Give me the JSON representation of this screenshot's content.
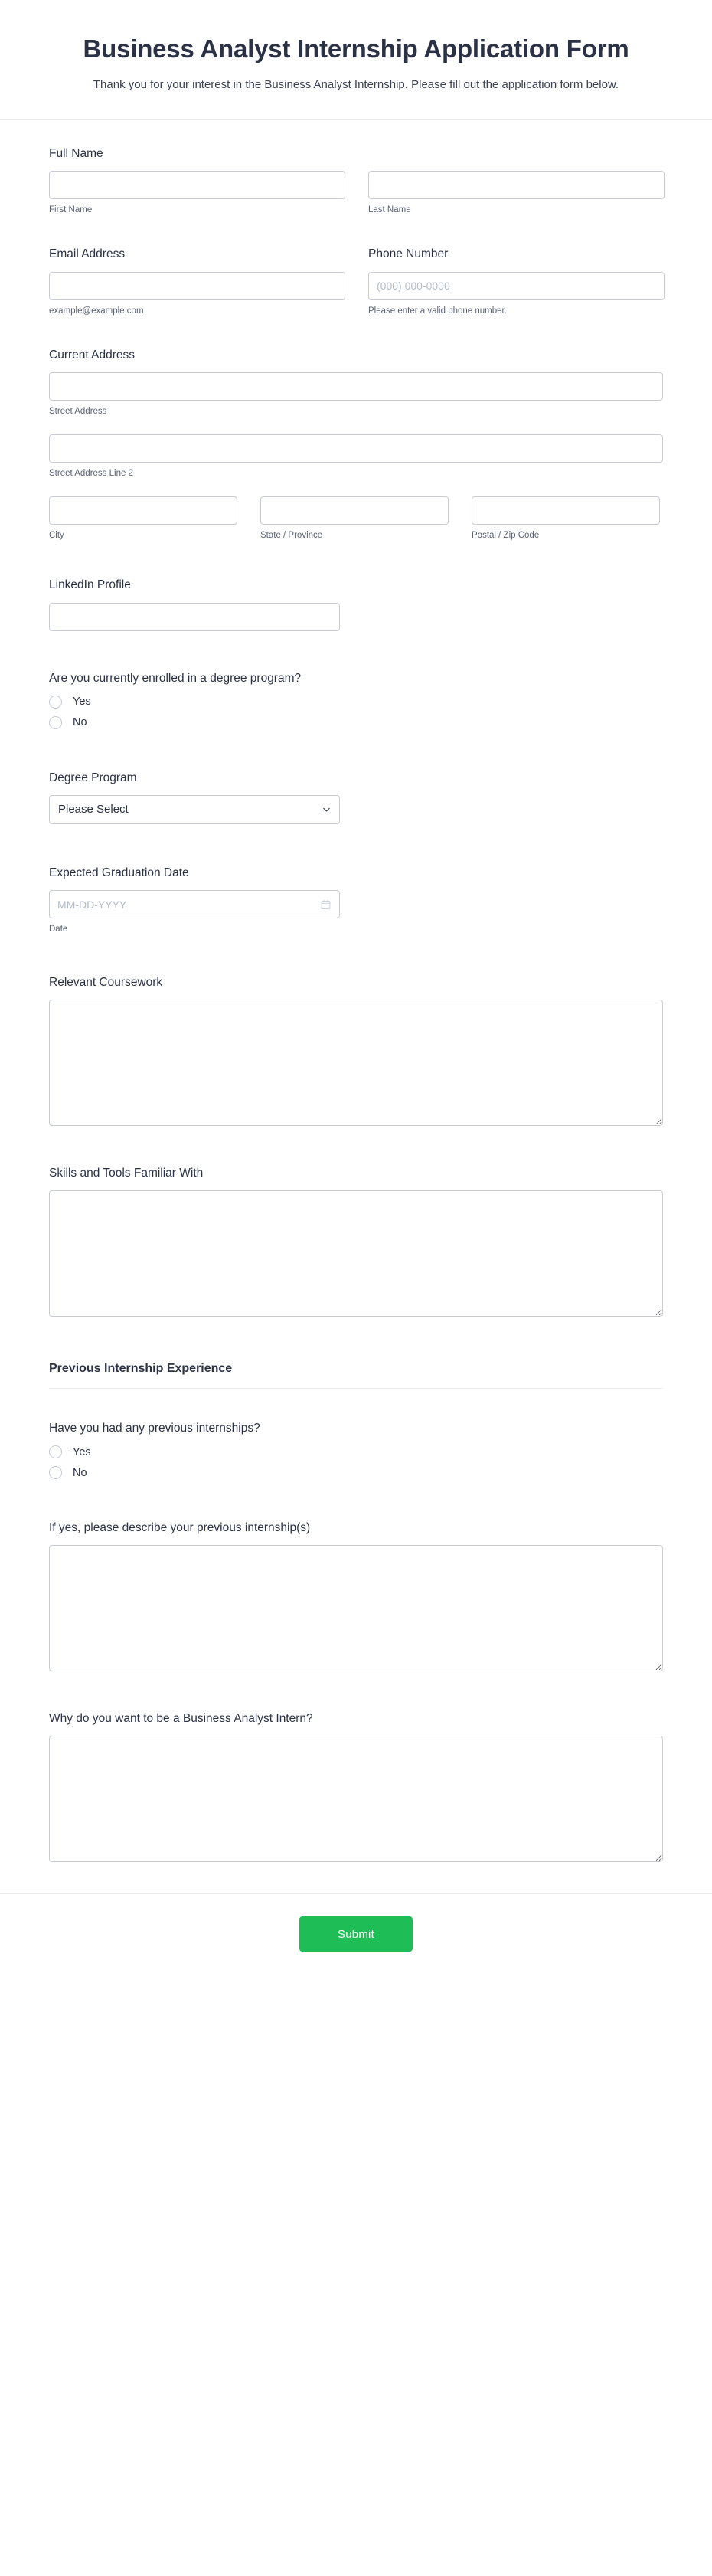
{
  "header": {
    "title": "Business Analyst Internship Application Form",
    "subtitle": "Thank you for your interest in the Business Analyst Internship. Please fill out the application form below."
  },
  "fields": {
    "full_name": {
      "label": "Full Name",
      "first": {
        "value": "",
        "placeholder": "",
        "sub_label": "First Name"
      },
      "last": {
        "value": "",
        "placeholder": "",
        "sub_label": "Last Name"
      }
    },
    "email": {
      "label": "Email Address",
      "value": "",
      "placeholder": "",
      "sub_label": "example@example.com"
    },
    "phone": {
      "label": "Phone Number",
      "value": "",
      "placeholder": "(000) 000-0000",
      "sub_label": "Please enter a valid phone number."
    },
    "address": {
      "label": "Current Address",
      "street": {
        "value": "",
        "placeholder": "",
        "sub_label": "Street Address"
      },
      "street2": {
        "value": "",
        "placeholder": "",
        "sub_label": "Street Address Line 2"
      },
      "city": {
        "value": "",
        "placeholder": "",
        "sub_label": "City"
      },
      "state": {
        "value": "",
        "placeholder": "",
        "sub_label": "State / Province"
      },
      "postal": {
        "value": "",
        "placeholder": "",
        "sub_label": "Postal / Zip Code"
      }
    },
    "linkedin": {
      "label": "LinkedIn Profile",
      "value": "",
      "placeholder": ""
    },
    "enrolled": {
      "label": "Are you currently enrolled in a degree program?",
      "options": [
        {
          "label": "Yes",
          "selected": false
        },
        {
          "label": "No",
          "selected": false
        }
      ]
    },
    "degree_program": {
      "label": "Degree Program",
      "selected": "Please Select",
      "icon": "chevron-down-icon"
    },
    "graduation_date": {
      "label": "Expected Graduation Date",
      "value": "",
      "placeholder": "MM-DD-YYYY",
      "sub_label": "Date",
      "icon": "calendar-icon"
    },
    "coursework": {
      "label": "Relevant Coursework",
      "value": "",
      "placeholder": ""
    },
    "skills": {
      "label": "Skills and Tools Familiar With",
      "value": "",
      "placeholder": ""
    }
  },
  "section_internship": {
    "title": "Previous Internship Experience",
    "had_internships": {
      "label": "Have you had any previous internships?",
      "options": [
        {
          "label": "Yes",
          "selected": false
        },
        {
          "label": "No",
          "selected": false
        }
      ]
    },
    "describe": {
      "label": "If yes, please describe your previous internship(s)",
      "value": "",
      "placeholder": ""
    },
    "why_intern": {
      "label": "Why do you want to be a Business Analyst Intern?",
      "value": "",
      "placeholder": ""
    }
  },
  "footer": {
    "submit_label": "Submit"
  },
  "colors": {
    "submit_green": "#1fbd55",
    "text_primary": "#2b3245",
    "text_sub": "#5a6275",
    "border": "#c9ccd4",
    "divider": "#e9eaee",
    "placeholder": "#b4bcc8"
  }
}
